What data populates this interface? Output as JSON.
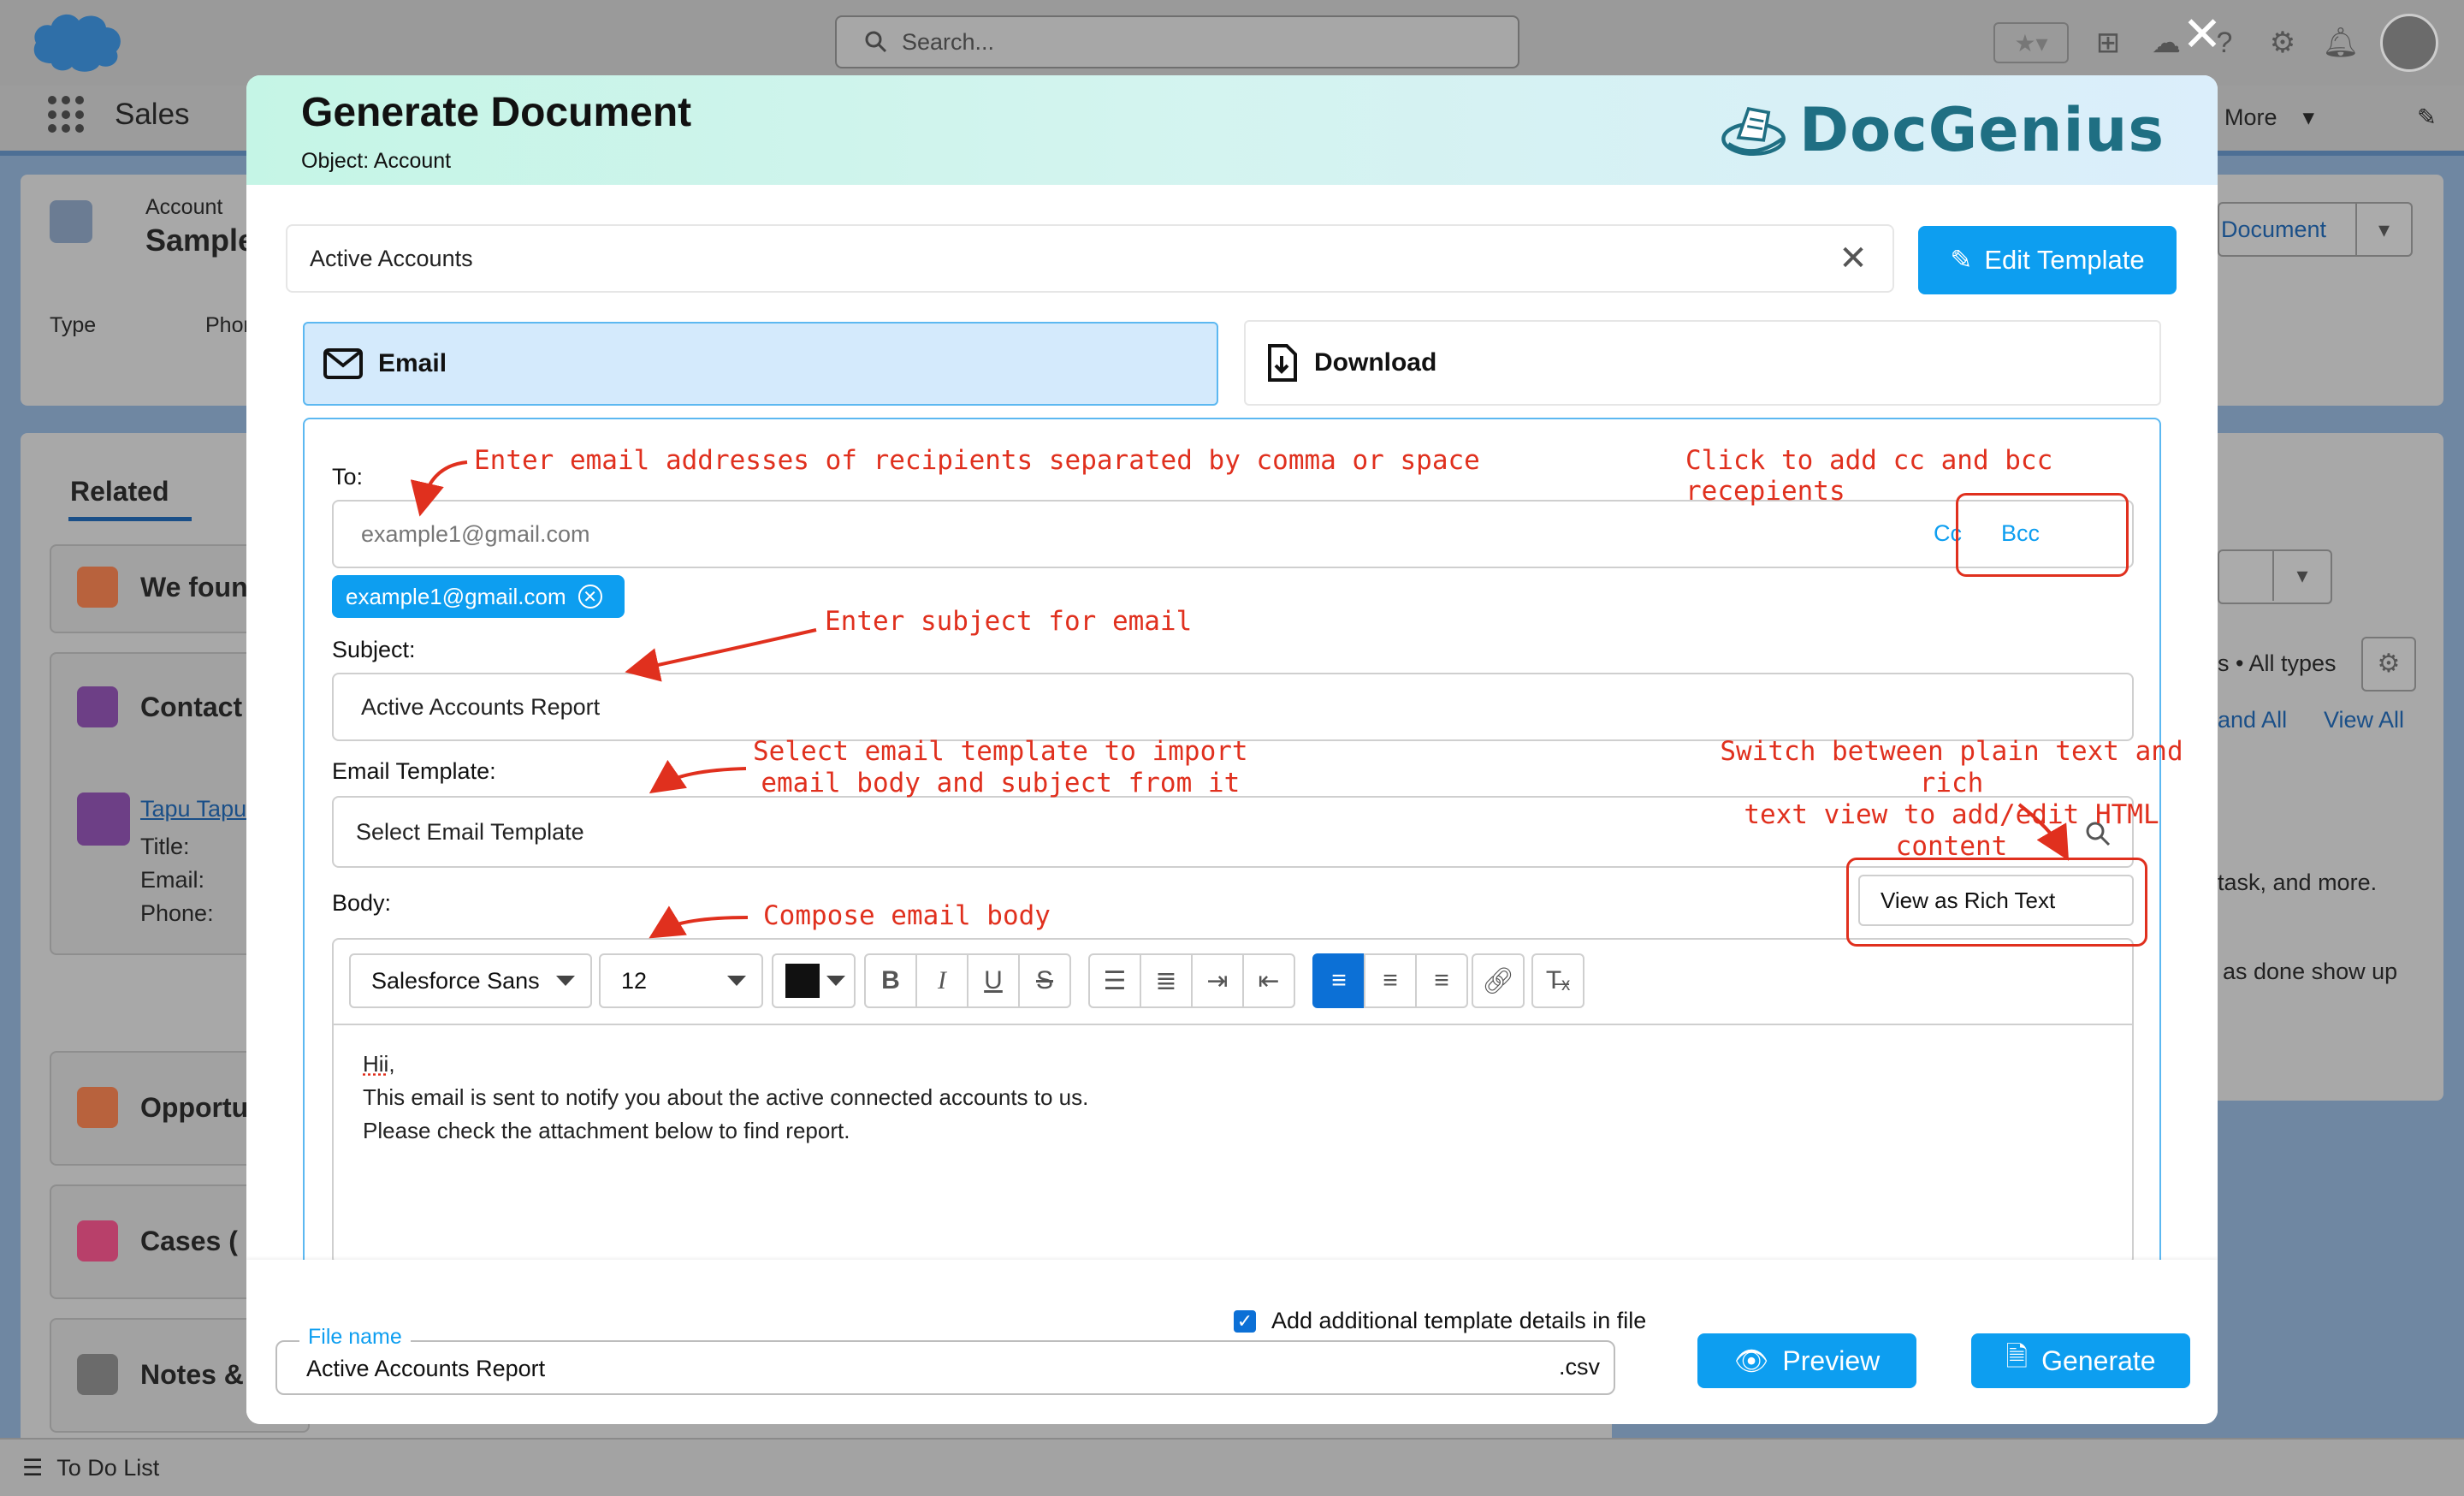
{
  "background": {
    "search_placeholder": "Search...",
    "app_name": "Sales",
    "nav_more": "More",
    "record": {
      "object_label": "Account",
      "name": "Sample",
      "fields": [
        "Type",
        "Phon"
      ]
    },
    "related_tab": "Related",
    "cards": [
      "We foun",
      "Contact",
      "Opportu",
      "Cases (",
      "Notes &"
    ],
    "contact": {
      "name": "Tapu Tapu",
      "lines": [
        "Title:",
        "Email:",
        "Phone:"
      ]
    },
    "right_panel": {
      "doc_button": "Document",
      "filter_text": "s • All types",
      "expand": "and All",
      "view_all": "View All",
      "text1": "task, and more.",
      "text2": "as done show up"
    },
    "todo": "To Do List"
  },
  "modal": {
    "title": "Generate Document",
    "object_line": "Object: Account",
    "logo_text": "DocGenius",
    "template_name": "Active Accounts",
    "edit_template_label": "Edit Template",
    "tabs": {
      "email": "Email",
      "download": "Download"
    },
    "to": {
      "label": "To:",
      "placeholder": "example1@gmail.com",
      "cc": "Cc",
      "bcc": "Bcc",
      "recipients": [
        "example1@gmail.com"
      ]
    },
    "subject": {
      "label": "Subject:",
      "value": "Active Accounts Report"
    },
    "email_template": {
      "label": "Email Template:",
      "placeholder": "Select Email Template"
    },
    "body": {
      "label": "Body:",
      "view_rich_label": "View as Rich Text",
      "font": "Salesforce Sans",
      "size": "12",
      "text_color": "#111111",
      "lines": [
        "Hii,",
        "This email is sent to notify you about the active connected accounts to us.",
        "Please check the attachment below to find report."
      ]
    },
    "annotations": {
      "to": "Enter email addresses of recipients separated by comma or space",
      "cc": "Click to add cc and bcc recepients",
      "subject": "Enter subject for email",
      "template_1": "Select email template to import",
      "template_2": "email body and subject from it",
      "rich_1": "Switch between plain text and rich",
      "rich_2": "text view to add/edit HTML content",
      "body": "Compose email body"
    },
    "footer": {
      "checkbox_label": "Add additional template details in file",
      "checkbox_checked": true,
      "file_name_label": "File name",
      "file_name": "Active Accounts Report",
      "extension": ".csv",
      "preview_label": "Preview",
      "generate_label": "Generate"
    }
  },
  "colors": {
    "accent": "#0d9ef0",
    "annotation": "#e0301e",
    "active_tab": "#d4eafc"
  }
}
